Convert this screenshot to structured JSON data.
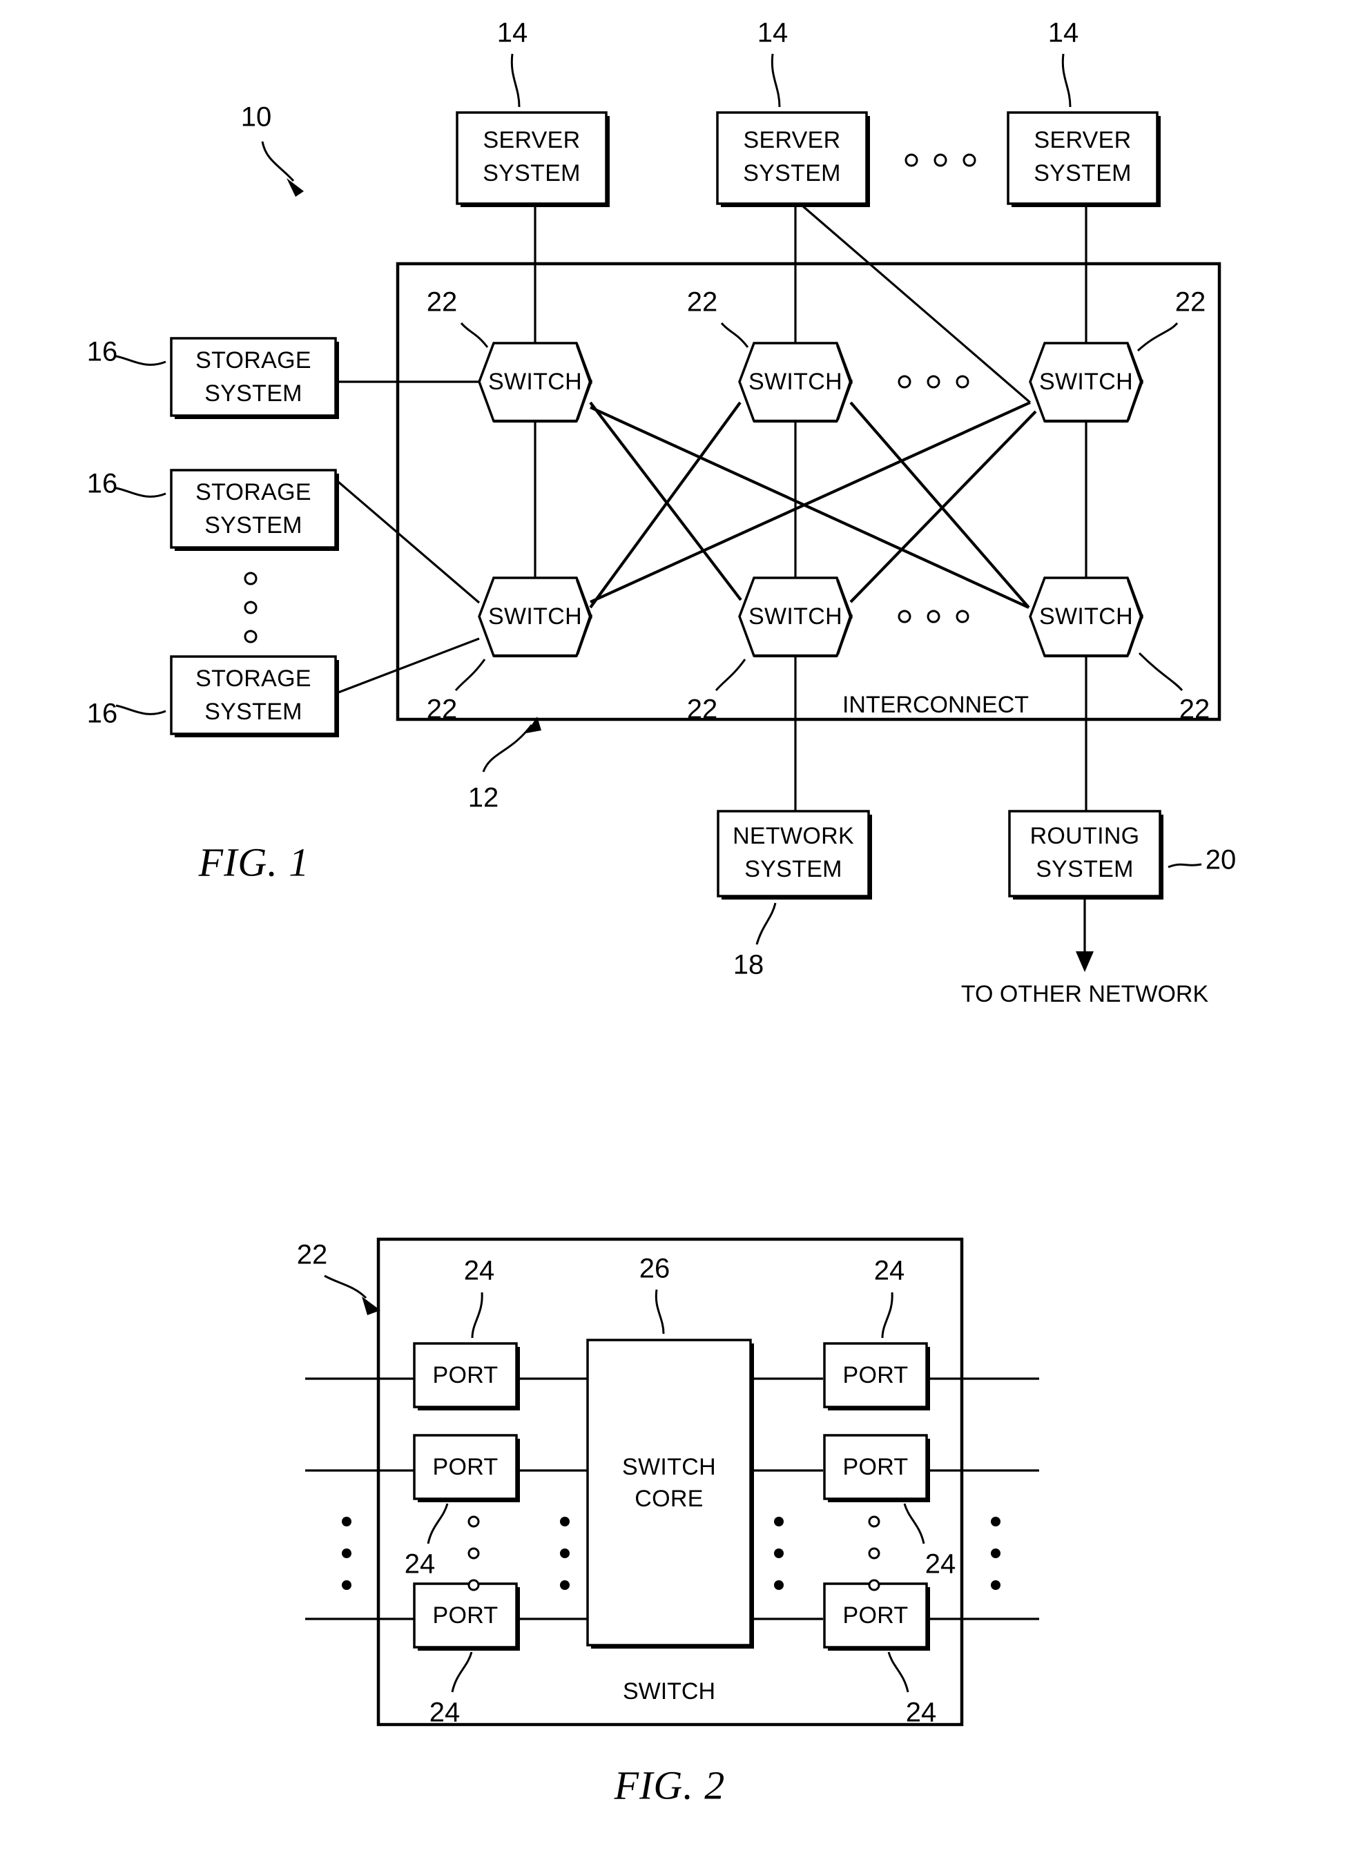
{
  "figure1": {
    "caption": "FIG. 1",
    "system_ref": "10",
    "interconnect_ref": "12",
    "interconnect_label": "INTERCONNECT",
    "servers": [
      {
        "ref": "14",
        "line1": "SERVER",
        "line2": "SYSTEM"
      },
      {
        "ref": "14",
        "line1": "SERVER",
        "line2": "SYSTEM"
      },
      {
        "ref": "14",
        "line1": "SERVER",
        "line2": "SYSTEM"
      }
    ],
    "server_ellipsis": "o o o",
    "storages": [
      {
        "ref": "16",
        "line1": "STORAGE",
        "line2": "SYSTEM"
      },
      {
        "ref": "16",
        "line1": "STORAGE",
        "line2": "SYSTEM"
      },
      {
        "ref": "16",
        "line1": "STORAGE",
        "line2": "SYSTEM"
      }
    ],
    "switches_top": [
      {
        "ref": "22",
        "label": "SWITCH"
      },
      {
        "ref": "22",
        "label": "SWITCH"
      },
      {
        "ref": "22",
        "label": "SWITCH"
      }
    ],
    "switches_bottom": [
      {
        "ref": "22",
        "label": "SWITCH"
      },
      {
        "ref": "22",
        "label": "SWITCH"
      },
      {
        "ref": "22",
        "label": "SWITCH"
      }
    ],
    "network_system": {
      "ref": "18",
      "line1": "NETWORK",
      "line2": "SYSTEM"
    },
    "routing_system": {
      "ref": "20",
      "line1": "ROUTING",
      "line2": "SYSTEM"
    },
    "to_other_network": "TO OTHER NETWORK"
  },
  "figure2": {
    "caption": "FIG. 2",
    "switch_ref": "22",
    "switch_label": "SWITCH",
    "core_ref": "26",
    "core_line1": "SWITCH",
    "core_line2": "CORE",
    "port_label": "PORT",
    "port_refs_left": [
      "24",
      "24",
      "24"
    ],
    "port_refs_right": [
      "24",
      "24",
      "24"
    ]
  }
}
